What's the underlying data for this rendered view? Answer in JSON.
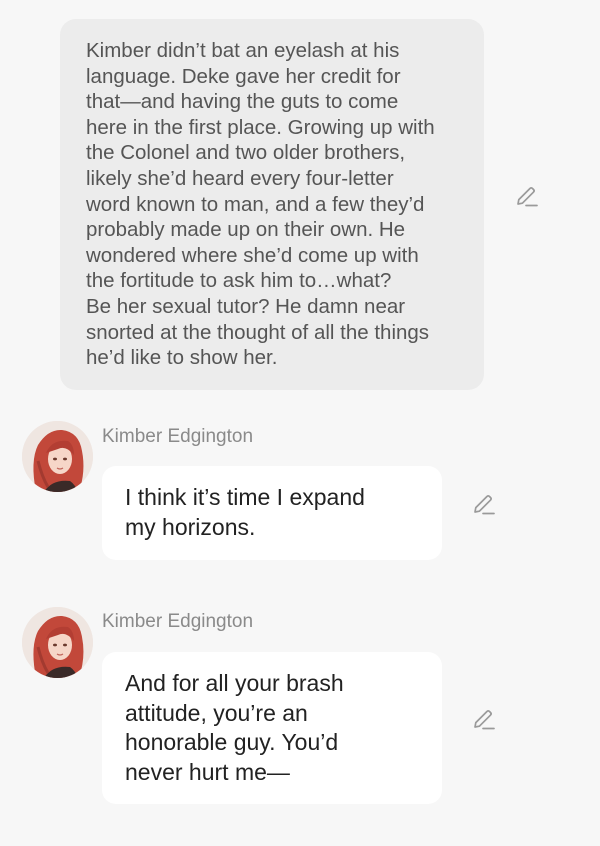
{
  "narration": {
    "text": "Kimber didn’t bat an eyelash at his\nlanguage. Deke gave her credit for\nthat—and having the guts to come\nhere in the first place. Growing up with\nthe Colonel and two older brothers,\nlikely she’d heard every four-letter\nword known to man, and a few they’d\nprobably made up on their own. He\nwondered where she’d come up with\nthe fortitude to ask him to…what?\nBe her sexual tutor? He damn near\nsnorted at the thought of all the things\nhe’d like to show her."
  },
  "messages": [
    {
      "sender": "Kimber Edgington",
      "text": "I think it’s time I expand\nmy horizons."
    },
    {
      "sender": "Kimber Edgington",
      "text": "And for all your brash\nattitude, you’re an\nhonorable guy. You’d\nnever hurt me—"
    }
  ],
  "icons": {
    "edit": "pencil-edit-icon",
    "avatar": "red-haired-woman-avatar"
  },
  "colors": {
    "background": "#f7f7f7",
    "narration_bubble": "#ececec",
    "message_bubble": "#ffffff",
    "sender_name": "#8a8a8a",
    "icon": "#9a9a9a"
  }
}
